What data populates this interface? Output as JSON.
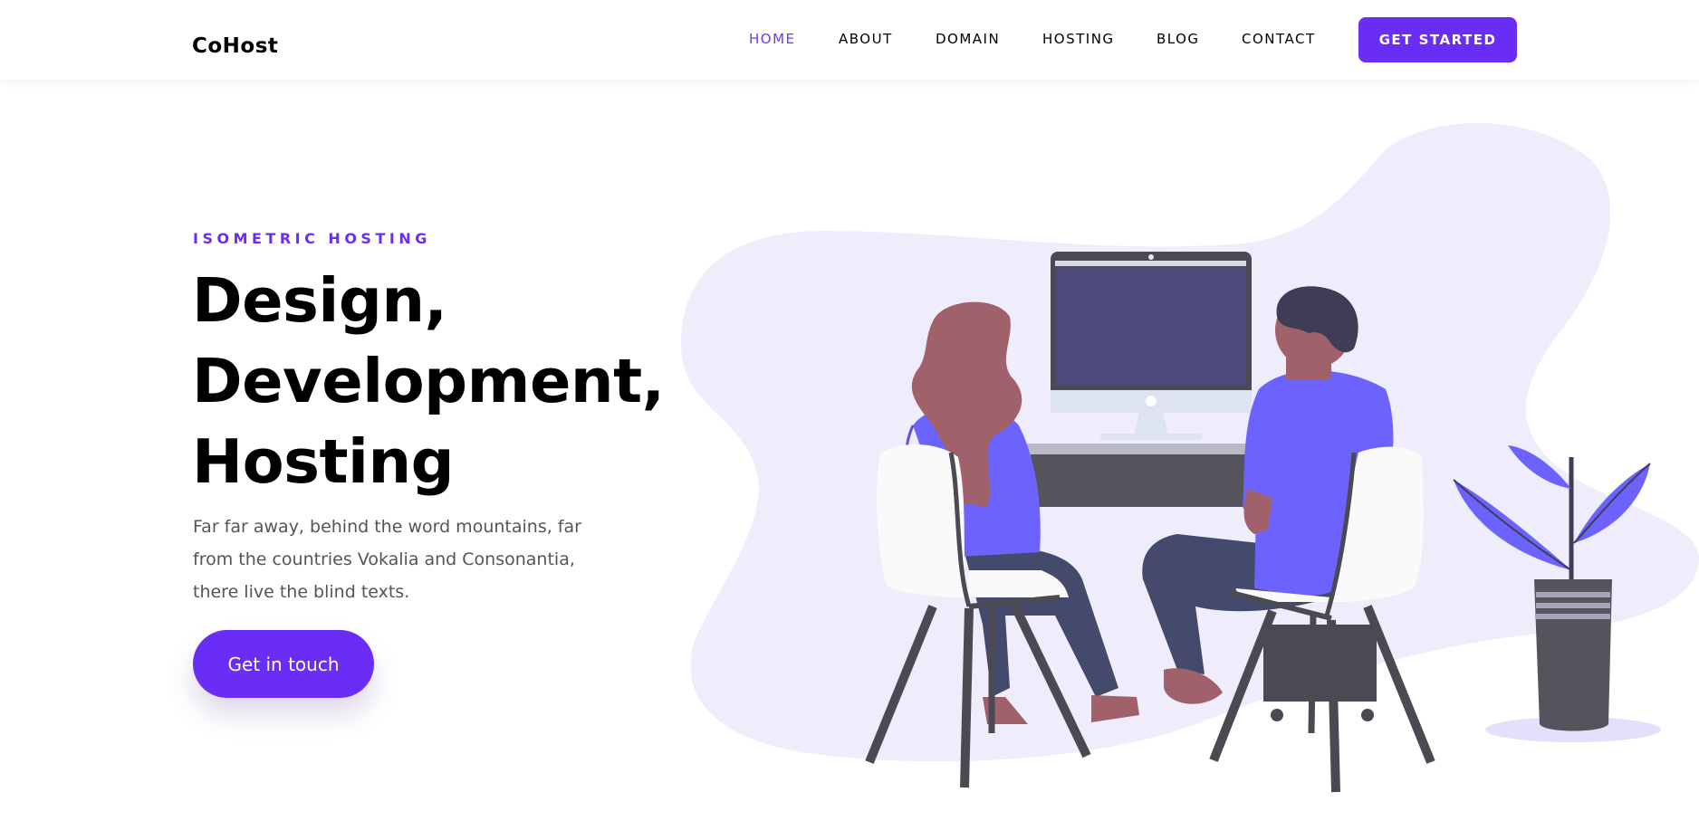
{
  "navbar": {
    "brand": "CoHost",
    "links": [
      "HOME",
      "ABOUT",
      "DOMAIN",
      "HOSTING",
      "BLOG",
      "CONTACT"
    ],
    "active_link": "HOME",
    "cta_label": "GET STARTED"
  },
  "hero": {
    "eyebrow": "ISOMETRIC HOSTING",
    "headline": [
      "Design,",
      "Development,",
      "Hosting"
    ],
    "lede": [
      "Far far away, behind the word mountains, far",
      "from the countries Vokalia and Consonantia,",
      "there live the blind texts."
    ],
    "button_label": "Get in touch"
  },
  "colors": {
    "accent": "#6a2df5",
    "active_link": "#6a3cf0",
    "blob": "#efedfc",
    "shirt": "#6c63ff",
    "dark": "#4b4a53"
  },
  "illustration": {
    "icon": "two-people-at-computer-illustration"
  }
}
